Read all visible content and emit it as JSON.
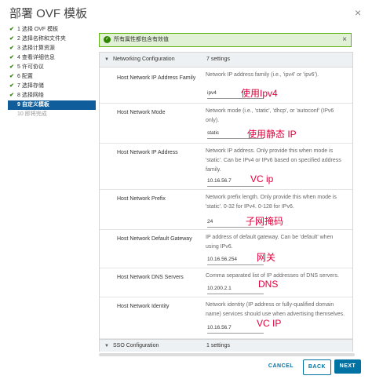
{
  "window": {
    "title": "部署 OVF 模板",
    "close_glyph": "×"
  },
  "steps": [
    {
      "label": "1 选择 OVF 模板",
      "state": "done"
    },
    {
      "label": "2 选择名称和文件夹",
      "state": "done"
    },
    {
      "label": "3 选择计算资源",
      "state": "done"
    },
    {
      "label": "4 查看详细信息",
      "state": "done"
    },
    {
      "label": "5 许可协议",
      "state": "done"
    },
    {
      "label": "6 配置",
      "state": "done"
    },
    {
      "label": "7 选择存储",
      "state": "done"
    },
    {
      "label": "8 选择网络",
      "state": "done"
    },
    {
      "label": "9 自定义模板",
      "state": "active"
    },
    {
      "label": "10 即将完成",
      "state": "pending"
    }
  ],
  "alert": {
    "text": "所有属性都包含有效值",
    "status_color": "#2f8400"
  },
  "group_networking": {
    "name": "Networking Configuration",
    "count": "7 settings"
  },
  "group_sso": {
    "name": "SSO Configuration",
    "count": "1 settings"
  },
  "rows": [
    {
      "label": "Host Network IP Address Family",
      "desc": "Network IP address family (i.e., 'ipv4' or 'ipv6').",
      "value": "ipv4",
      "annotation": "使用Ipv4"
    },
    {
      "label": "Host Network Mode",
      "desc": "Network mode (i.e., 'static', 'dhcp', or 'autoconf' (IPv6 only).",
      "value": "static",
      "annotation": "使用静态 IP"
    },
    {
      "label": "Host Network IP Address",
      "desc": "Network IP address. Only provide this when mode is 'static'. Can be IPv4 or IPv6 based on specified address family.",
      "value": "10.16.56.7",
      "annotation": "VC ip"
    },
    {
      "label": "Host Network Prefix",
      "desc": "Network prefix length. Only provide this when mode is 'static'. 0-32 for IPv4. 0-128 for IPv6.",
      "value": "24",
      "annotation": "子网掩码"
    },
    {
      "label": "Host Network Default Gateway",
      "desc": "IP address of default gateway. Can be 'default' when using IPv6.",
      "value": "10.16.56.254",
      "annotation": "网关"
    },
    {
      "label": "Host Network DNS Servers",
      "desc": "Comma separated list of IP addresses of DNS servers.",
      "value": "10.200.2.1",
      "annotation": "DNS"
    },
    {
      "label": "Host Network Identity",
      "desc": "Network identity (IP address or fully-qualified domain name) services should use when advertising themselves.",
      "value": "10.16.56.7",
      "annotation": "VC IP"
    }
  ],
  "buttons": {
    "cancel": "CANCEL",
    "back": "BACK",
    "next": "NEXT"
  },
  "colors": {
    "primary": "#0072a3",
    "active_step": "#0f5d9a",
    "annotation": "#e1003c",
    "success_bg": "#e1f1d6"
  }
}
